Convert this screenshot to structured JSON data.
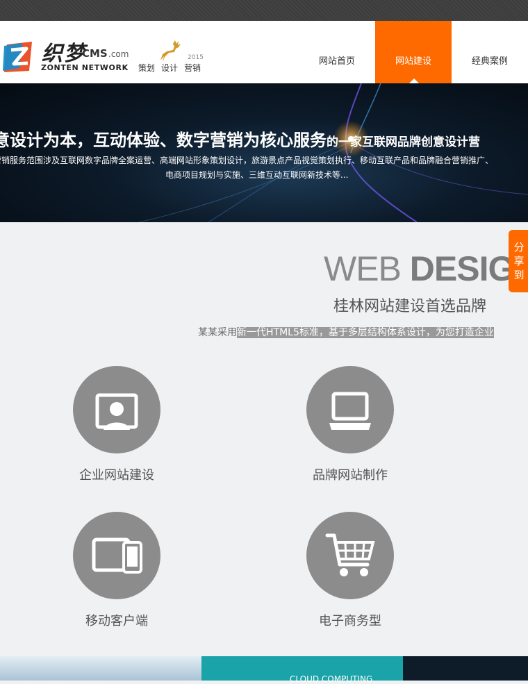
{
  "header": {
    "logo_cn": "织梦",
    "logo_cms": "CMS",
    "logo_com": ".com",
    "logo_en": "ZONTEN NETWORK",
    "year": "2015",
    "slogan": [
      "策划",
      "设计",
      "营销"
    ]
  },
  "nav": {
    "items": [
      {
        "label": "网站首页",
        "active": false
      },
      {
        "label": "网站建设",
        "active": true
      },
      {
        "label": "经典案例",
        "active": false
      }
    ]
  },
  "banner": {
    "headline_big": "意设计为本，互动体验、数字营销为核心服务",
    "headline_small": "的一家互联网品牌创意设计营",
    "line1": "营销服务范围涉及互联网数字品牌全案运营、高端网站形象策划设计，旅游景点产品视觉策划执行、移动互联产品和品牌融合营销推广、",
    "line2": "电商项目规划与实施、三维互动互联网新技术等..."
  },
  "section": {
    "title_light": "WEB ",
    "title_bold": "DESIGN",
    "subtitle": "桂林网站建设首选品牌",
    "desc_plain": "某某采用",
    "desc_highlight": "新一代HTML5标准，基于多层结构体系设计，为您打造企业"
  },
  "share": {
    "chars": [
      "分",
      "享",
      "到"
    ]
  },
  "services": [
    {
      "label": "企业网站建设",
      "icon": "user-monitor-icon"
    },
    {
      "label": "品牌网站制作",
      "icon": "laptop-icon"
    },
    {
      "label": "移动客户端",
      "icon": "tablet-phone-icon"
    },
    {
      "label": "电子商务型",
      "icon": "shopping-cart-icon"
    }
  ],
  "bottom": {
    "cloud_text": "CLOUD COMPUTING"
  },
  "colors": {
    "accent": "#ff6a00",
    "icon_circle": "#8c8c8c",
    "topbar": "#3d3d3d",
    "teal": "#1aa3a8"
  }
}
